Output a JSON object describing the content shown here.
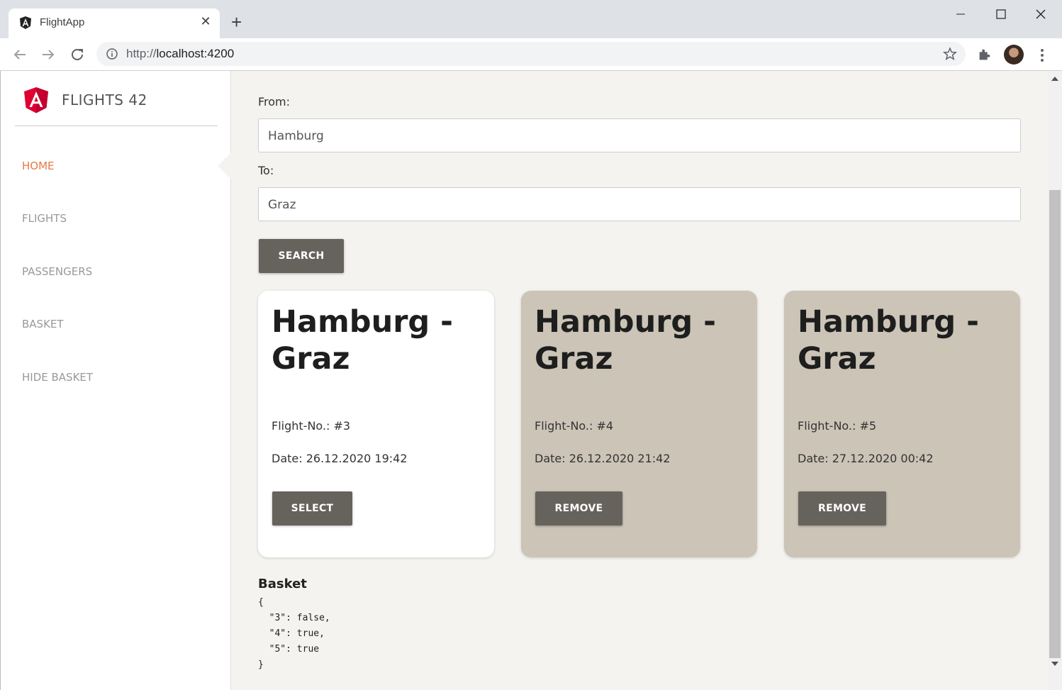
{
  "browser": {
    "tab_title": "FlightApp",
    "tab_close": "✕",
    "new_tab": "+",
    "url_scheme": "http://",
    "url_host": "localhost:4200",
    "minimize": "—",
    "maximize": "☐",
    "close": "✕"
  },
  "sidebar": {
    "brand": "FLIGHTS 42",
    "items": [
      {
        "label": "HOME",
        "active": true
      },
      {
        "label": "FLIGHTS"
      },
      {
        "label": "PASSENGERS"
      },
      {
        "label": "BASKET"
      },
      {
        "label": "HIDE BASKET"
      }
    ]
  },
  "search": {
    "from_label": "From:",
    "from_value": "Hamburg",
    "to_label": "To:",
    "to_value": "Graz",
    "button": "SEARCH"
  },
  "flights": [
    {
      "title": "Hamburg - Graz",
      "number": "Flight-No.: #3",
      "date": "Date: 26.12.2020 19:42",
      "button": "SELECT",
      "selected": false
    },
    {
      "title": "Hamburg - Graz",
      "number": "Flight-No.: #4",
      "date": "Date: 26.12.2020 21:42",
      "button": "REMOVE",
      "selected": true
    },
    {
      "title": "Hamburg - Graz",
      "number": "Flight-No.: #5",
      "date": "Date: 27.12.2020 00:42",
      "button": "REMOVE",
      "selected": true
    }
  ],
  "basket": {
    "title": "Basket",
    "json": "{\n  \"3\": false,\n  \"4\": true,\n  \"5\": true\n}"
  },
  "colors": {
    "accent": "#e57a44",
    "button": "#66625c",
    "selected_card": "#cbc4b7",
    "angular_red": "#dd0031"
  }
}
